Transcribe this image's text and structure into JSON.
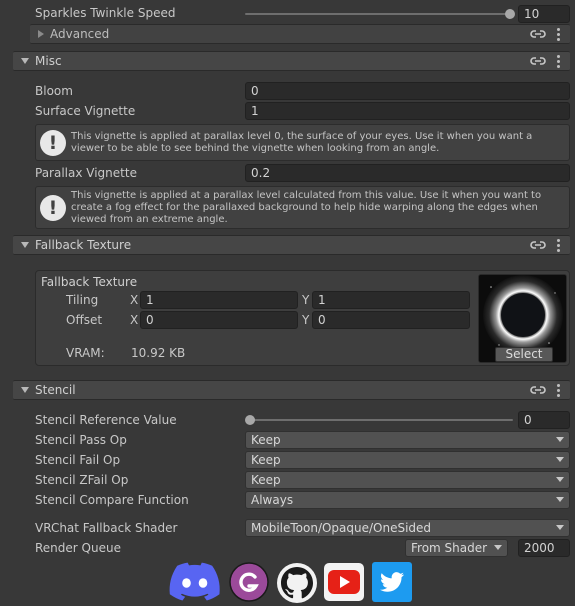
{
  "top": {
    "sparkles_label": "Sparkles Twinkle Speed",
    "sparkles_value": "10",
    "sparkles_slider_fraction": 0.96,
    "advanced_label": "Advanced"
  },
  "misc": {
    "title": "Misc",
    "bloom_label": "Bloom",
    "bloom_value": "0",
    "surface_label": "Surface Vignette",
    "surface_value": "1",
    "surface_help": "This vignette is applied at parallax level 0, the surface of your eyes. Use it when you want a viewer to be able to see behind the vignette when looking from an angle.",
    "parallax_label": "Parallax Vignette",
    "parallax_value": "0.2",
    "parallax_help": "This vignette is applied at a parallax level calculated from this value. Use it when you want to create a fog effect for the parallaxed background to help hide warping along the edges when viewed from an extreme angle."
  },
  "fallback": {
    "title": "Fallback Texture",
    "box_title": "Fallback Texture",
    "tiling_label": "Tiling",
    "offset_label": "Offset",
    "x_label": "X",
    "y_label": "Y",
    "tiling_x": "1",
    "tiling_y": "1",
    "offset_x": "0",
    "offset_y": "0",
    "vram_label": "VRAM:",
    "vram_value": "10.92 KB",
    "select_label": "Select"
  },
  "stencil": {
    "title": "Stencil",
    "ref_label": "Stencil Reference Value",
    "ref_value": "0",
    "ref_slider_fraction": 0.0,
    "pass_label": "Stencil Pass Op",
    "pass_value": "Keep",
    "fail_label": "Stencil Fail Op",
    "fail_value": "Keep",
    "zfail_label": "Stencil ZFail Op",
    "zfail_value": "Keep",
    "compare_label": "Stencil Compare Function",
    "compare_value": "Always"
  },
  "bottom": {
    "fallback_shader_label": "VRChat Fallback Shader",
    "fallback_shader_value": "MobileToon/Opaque/OneSided",
    "render_queue_label": "Render Queue",
    "render_queue_mode": "From Shader",
    "render_queue_value": "2000"
  },
  "social_icons": [
    "discord-icon",
    "gumroad-icon",
    "github-icon",
    "youtube-icon",
    "twitter-icon"
  ],
  "colors": {
    "discord": "#5865f2",
    "gumroad": "#9b4a9a",
    "youtube": "#e62117",
    "twitter": "#1d9bf0"
  }
}
